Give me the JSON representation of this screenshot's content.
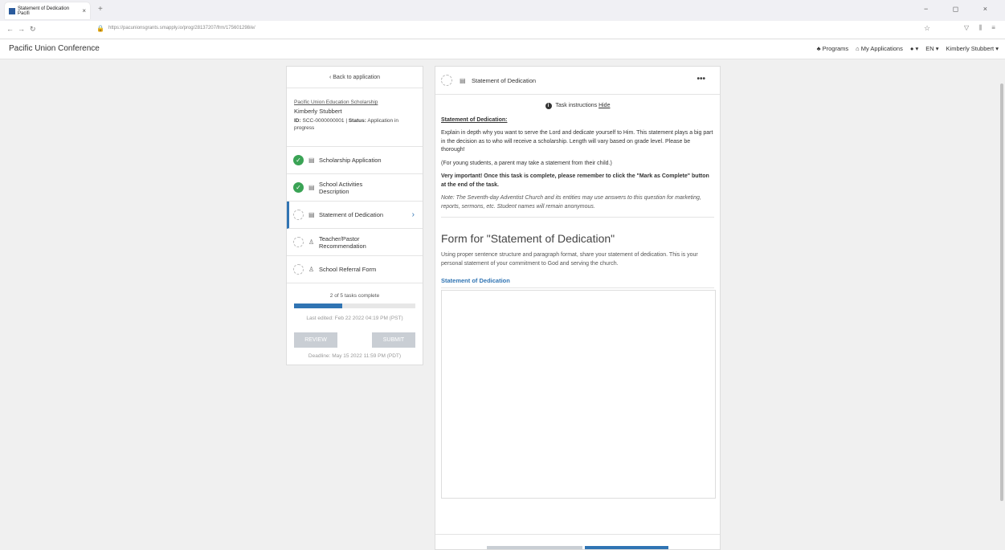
{
  "browser": {
    "tab_title": "Statement of Dedication Pacifi",
    "tab_close": "×",
    "new_tab": "+",
    "url": "https://pacunionsgrants.smapply.io/prog/28137207/frm/175601298/e/",
    "window_controls": "− ◻ ×"
  },
  "header": {
    "brand": "Pacific Union Conference",
    "nav": {
      "programs": "Programs",
      "my_applications": "My Applications",
      "help": "▾",
      "language": "EN ▾",
      "user": "Kimberly Stubbert ▾"
    }
  },
  "sidebar": {
    "back_label": "Back to application",
    "program_name": "Pacific Union Education Scholarship",
    "applicant_name": "Kimberly Stubbert",
    "id_label": "ID:",
    "id_value": "SCC-0000000001",
    "status_label": "Status:",
    "status_value": "Application in progress",
    "tasks": [
      {
        "label": "Scholarship Application",
        "complete": true,
        "icon": "document-icon"
      },
      {
        "label": "School Activities Description",
        "complete": true,
        "icon": "document-icon"
      },
      {
        "label": "Statement of Dedication",
        "complete": false,
        "icon": "document-icon",
        "active": true
      },
      {
        "label": "Teacher/Pastor Recommendation",
        "complete": false,
        "icon": "thumbs-up-icon"
      },
      {
        "label": "School Referral Form",
        "complete": false,
        "icon": "thumbs-up-icon"
      }
    ],
    "progress_text": "2 of 5 tasks complete",
    "progress_fraction": 0.4,
    "last_edited": "Last edited: Feb 22 2022 04:19 PM (PST)",
    "review_label": "REVIEW",
    "submit_label": "SUBMIT",
    "deadline": "Deadline: May 15 2022 11:59 PM (PDT)"
  },
  "task": {
    "title": "Statement of Dedication",
    "more": "•••",
    "instructions_toggle_label": "Task instructions",
    "hide_label": "Hide",
    "instructions_title": "Statement of Dedication:",
    "instructions_p1": "Explain in depth why you want to serve the Lord and dedicate yourself to Him. This statement plays a big part in the decision as to who will receive a scholarship. Length will vary based on grade level. Please be thorough!",
    "instructions_p2": "(For young students, a parent may take a statement from their child.)",
    "instructions_p3": "Very important! Once this task is complete, please remember to click the \"Mark as Complete\" button at the end of the task.",
    "instructions_note": "Note: The Seventh-day Adventist Church and its entities may use answers to this question for marketing, reports, sermons, etc. Student names will remain anonymous.",
    "form_title": "Form for \"Statement of Dedication\"",
    "form_desc": "Using proper sentence structure and paragraph format, share your statement of dedication. This is your personal statement of your commitment to God and serving the church.",
    "field_label": "Statement of Dedication",
    "field_value": ""
  },
  "colors": {
    "accent": "#3074b3",
    "complete": "#3aa355",
    "disabled_button": "#c9ced4"
  }
}
